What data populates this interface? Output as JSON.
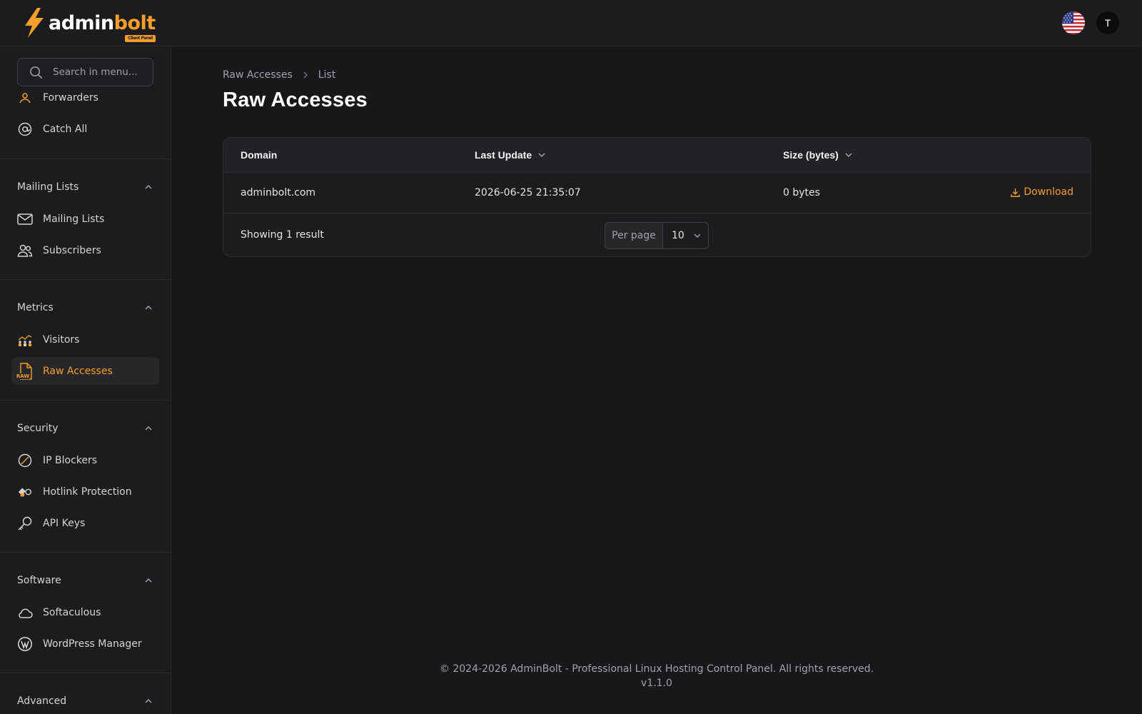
{
  "brand": {
    "part1": "admin",
    "part2": "bolt",
    "badge": "Client Panel"
  },
  "header": {
    "avatar_initial": "T",
    "flag_icon": "us-flag-icon"
  },
  "sidebar": {
    "search_placeholder": "Search in menu...",
    "items_top": [
      {
        "label": "Forwarders",
        "icon": "forwarders-icon"
      },
      {
        "label": "Catch All",
        "icon": "at-sign-icon"
      }
    ],
    "groups": [
      {
        "title": "Mailing Lists",
        "items": [
          {
            "label": "Mailing Lists",
            "icon": "envelope-icon"
          },
          {
            "label": "Subscribers",
            "icon": "users-icon"
          }
        ]
      },
      {
        "title": "Metrics",
        "items": [
          {
            "label": "Visitors",
            "icon": "visitors-icon"
          },
          {
            "label": "Raw Accesses",
            "icon": "raw-file-icon",
            "active": true
          }
        ]
      },
      {
        "title": "Security",
        "items": [
          {
            "label": "IP Blockers",
            "icon": "ban-icon"
          },
          {
            "label": "Hotlink Protection",
            "icon": "hotlink-icon"
          },
          {
            "label": "API Keys",
            "icon": "key-icon"
          }
        ]
      },
      {
        "title": "Software",
        "items": [
          {
            "label": "Softaculous",
            "icon": "cloud-icon"
          },
          {
            "label": "WordPress Manager",
            "icon": "wordpress-icon"
          }
        ]
      },
      {
        "title": "Advanced",
        "items": []
      }
    ],
    "raw_icon_text": "RAW"
  },
  "breadcrumb": {
    "root": "Raw Accesses",
    "current": "List"
  },
  "page_title": "Raw Accesses",
  "table": {
    "columns": [
      "Domain",
      "Last Update",
      "Size (bytes)"
    ],
    "rows": [
      {
        "domain": "adminbolt.com",
        "last_update": "2026-06-25 21:35:07",
        "size": "0 bytes",
        "action": "Download"
      }
    ],
    "showing": "Showing 1 result",
    "per_page_label": "Per page",
    "per_page_value": "10"
  },
  "footer": {
    "copyright": "© 2024-2026 AdminBolt - Professional Linux Hosting Control Panel. All rights reserved.",
    "version": "v1.1.0"
  },
  "colors": {
    "accent": "#f59e2c",
    "background": "#18181b",
    "panel": "#1c1c1f"
  }
}
